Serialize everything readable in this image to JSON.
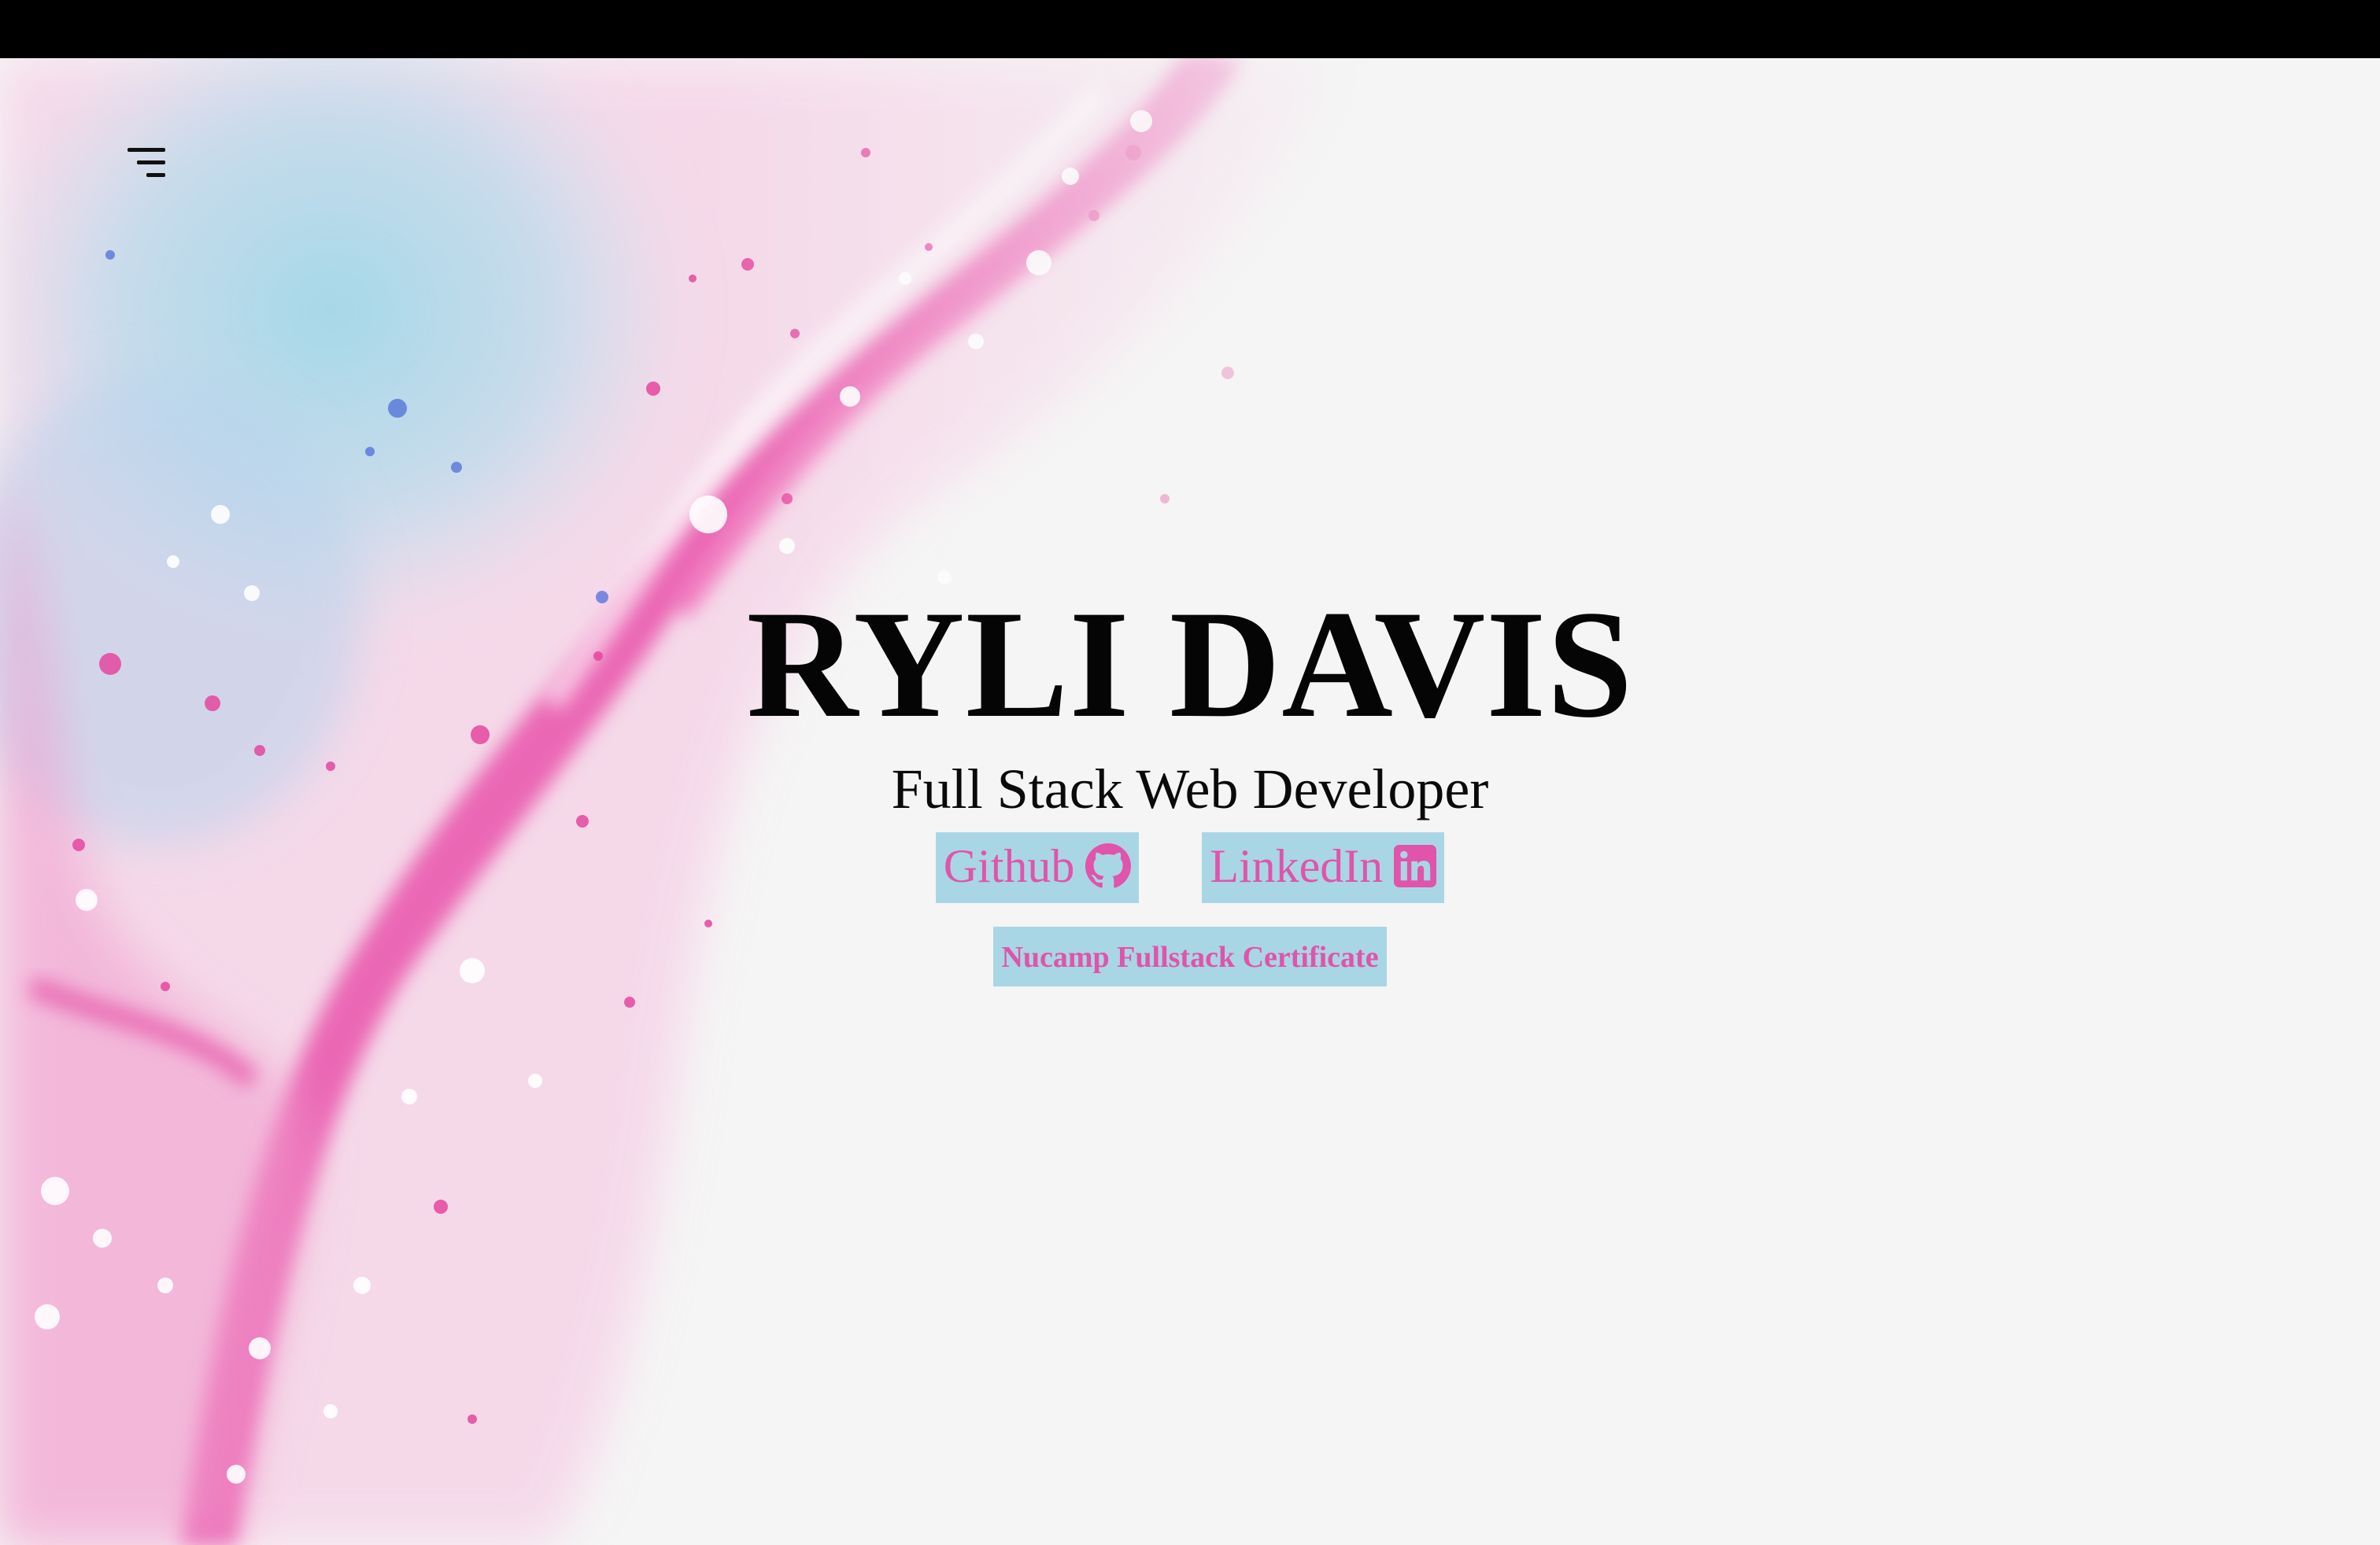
{
  "header": {
    "menu_icon": "hamburger-menu-icon"
  },
  "hero": {
    "name": "RYLI DAVIS",
    "subtitle": "Full Stack Web Developer"
  },
  "links": {
    "github_label": "Github",
    "github_icon": "github-icon",
    "linkedin_label": "LinkedIn",
    "linkedin_icon": "linkedin-icon",
    "certificate_label": "Nucamp Fullstack Certificate"
  },
  "colors": {
    "top_bar": "#000000",
    "link_background": "#a9d6e5",
    "link_text": "#e054ab",
    "page_background": "#f5f5f5"
  }
}
